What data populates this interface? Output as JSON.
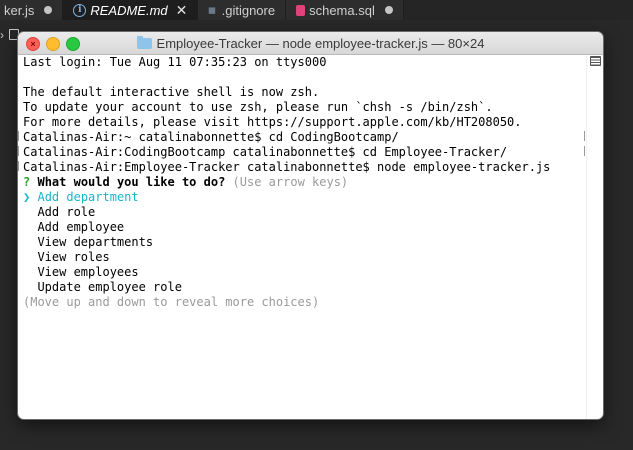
{
  "editor": {
    "tabs": [
      {
        "label": "ker.js",
        "icon": "js-file-icon",
        "state": "modified"
      },
      {
        "label": "README.md",
        "icon": "info-icon",
        "state": "active"
      },
      {
        "label": ".gitignore",
        "icon": "git-icon",
        "state": "normal"
      },
      {
        "label": "schema.sql",
        "icon": "database-icon",
        "state": "modified"
      }
    ]
  },
  "terminal": {
    "title": "Employee-Tracker — node employee-tracker.js — 80×24",
    "lines": {
      "last_login": "Last login: Tue Aug 11 07:35:23 on ttys000",
      "zsh1": "The default interactive shell is now zsh.",
      "zsh2": "To update your account to use zsh, please run `chsh -s /bin/zsh`.",
      "zsh3": "For more details, please visit https://support.apple.com/kb/HT208050.",
      "cmd1": "Catalinas-Air:~ catalinabonnette$ cd CodingBootcamp/",
      "cmd2": "Catalinas-Air:CodingBootcamp catalinabonnette$ cd Employee-Tracker/",
      "cmd3": "Catalinas-Air:Employee-Tracker catalinabonnette$ node employee-tracker.js"
    },
    "prompt": {
      "marker": "?",
      "question": "What would you like to do?",
      "hint": "(Use arrow keys)",
      "pointer": "❯",
      "choices": [
        "Add department",
        "Add role",
        "Add employee",
        "View departments",
        "View roles",
        "View employees",
        "Update employee role"
      ],
      "more_hint": "(Move up and down to reveal more choices)"
    }
  },
  "colors": {
    "prompt_marker": "#2aa12a",
    "selected_choice": "#19b5c9",
    "hint_text": "#9a9a9a"
  }
}
